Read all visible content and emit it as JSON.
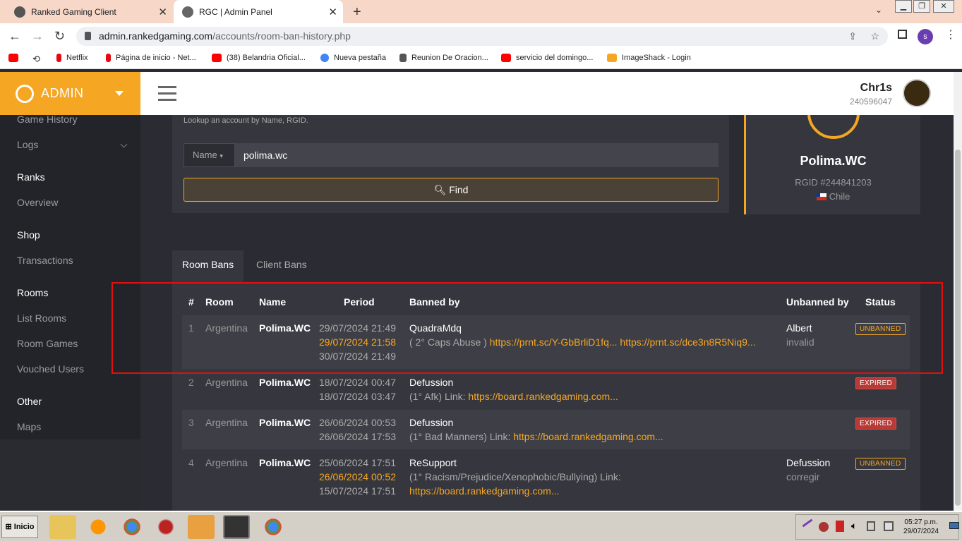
{
  "browser": {
    "tabs": [
      {
        "title": "Ranked Gaming Client"
      },
      {
        "title": "RGC | Admin Panel"
      }
    ],
    "url_host": "admin.rankedgaming.com",
    "url_path": "/accounts/room-ban-history.php",
    "profile_initial": "s",
    "bookmarks": [
      "Netflix",
      "Página de inicio - Net...",
      "(38) Belandria Oficial...",
      "Nueva pestaña",
      "Reunion De Oracion...",
      "servicio del domingo...",
      "ImageShack - Login"
    ]
  },
  "header": {
    "logo": "ADMIN",
    "user_name": "Chr1s",
    "user_id": "240596047"
  },
  "sidebar": {
    "items": [
      {
        "label": "Game History",
        "head": false
      },
      {
        "label": "Logs",
        "head": false
      },
      {
        "label": "Ranks",
        "head": true
      },
      {
        "label": "Overview",
        "head": false
      },
      {
        "label": "Shop",
        "head": true
      },
      {
        "label": "Transactions",
        "head": false
      },
      {
        "label": "Rooms",
        "head": true
      },
      {
        "label": "List Rooms",
        "head": false
      },
      {
        "label": "Room Games",
        "head": false
      },
      {
        "label": "Vouched Users",
        "head": false
      },
      {
        "label": "Other",
        "head": true
      },
      {
        "label": "Maps",
        "head": false
      }
    ]
  },
  "search": {
    "hint": "Lookup an account by Name, RGID.",
    "field": "Name",
    "value": "polima.wc",
    "button": "Find"
  },
  "profile": {
    "name": "Polima.WC",
    "rgid": "RGID #244841203",
    "country": "Chile"
  },
  "tabs": {
    "room": "Room Bans",
    "client": "Client Bans"
  },
  "table": {
    "headers": [
      "#",
      "Room",
      "Name",
      "Period",
      "Banned by",
      "Unbanned by",
      "Status"
    ],
    "rows": [
      {
        "num": "1",
        "room": "Argentina",
        "name": "Polima.WC",
        "p1": "29/07/2024 21:49",
        "p2": "29/07/2024 21:58",
        "p3": "30/07/2024 21:49",
        "by": "QuadraMdq",
        "reason": "( 2° Caps Abuse )",
        "link": "https://prnt.sc/Y-GbBrliD1fq... https://prnt.sc/dce3n8R5Niq9...",
        "unban": "Albert",
        "unban_reason": "invalid",
        "status": "UNBANNED"
      },
      {
        "num": "2",
        "room": "Argentina",
        "name": "Polima.WC",
        "p1": "18/07/2024 00:47",
        "p2": "18/07/2024 03:47",
        "by": "Defussion",
        "reason": "(1° Afk) Link:",
        "link": "https://board.rankedgaming.com...",
        "status": "EXPIRED"
      },
      {
        "num": "3",
        "room": "Argentina",
        "name": "Polima.WC",
        "p1": "26/06/2024 00:53",
        "p2": "26/06/2024 17:53",
        "by": "Defussion",
        "reason": "(1° Bad Manners) Link:",
        "link": "https://board.rankedgaming.com...",
        "status": "EXPIRED"
      },
      {
        "num": "4",
        "room": "Argentina",
        "name": "Polima.WC",
        "p1": "25/06/2024 17:51",
        "p2": "26/06/2024 00:52",
        "p3": "15/07/2024 17:51",
        "by": "ReSupport",
        "reason": "(1° Racism/Prejudice/Xenophobic/Bullying) Link:",
        "link": "https://board.rankedgaming.com...",
        "unban": "Defussion",
        "unban_reason": "corregir",
        "status": "UNBANNED"
      }
    ]
  },
  "taskbar": {
    "start": "Inicio",
    "time": "05:27 p.m.",
    "date": "29/07/2024"
  }
}
